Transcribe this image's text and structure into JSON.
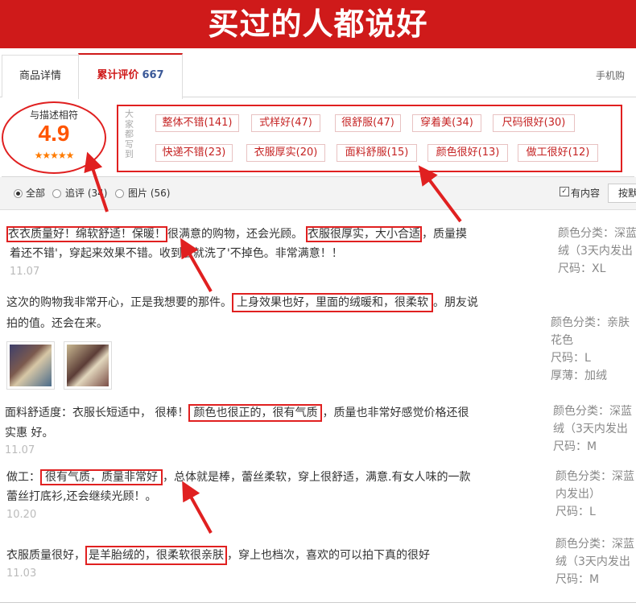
{
  "banner": {
    "title": "买过的人都说好"
  },
  "tabs": [
    {
      "label": "商品详情"
    },
    {
      "label": "累计评价",
      "count": "667"
    },
    {
      "label": "手机购"
    }
  ],
  "rating": {
    "label": "与描述相符",
    "score": "4.9",
    "stars": "★★★★★"
  },
  "tags": {
    "side_label": "大家都写到",
    "items": [
      "整体不错(141)",
      "式样好(47)",
      "很舒服(47)",
      "穿着美(34)",
      "尺码很好(30)",
      "快递不错(23)",
      "衣服厚实(20)",
      "面料舒服(15)",
      "颜色很好(13)",
      "做工很好(12)"
    ]
  },
  "filter": {
    "all": "全部",
    "followup": "追评 (34)",
    "images": "图片 (56)",
    "has_content": "有内容",
    "sort": "按默"
  },
  "reviews": [
    {
      "line1_hl1": "衣衣质量好！绵软舒适！保暖！",
      "line1_mid": "很满意的购物，还会光顾。",
      "line1_hl2": "衣服很厚实，大小合适",
      "line1_end": "，质量摸",
      "line2": "着还不错'，穿起来效果不错。收到后就洗了'不掉色。非常满意！！",
      "date": "11.07",
      "meta": [
        "颜色分类：深蓝",
        "绒（3天内发出",
        "尺码：XL"
      ]
    },
    {
      "line1_start": "这次的购物我非常开心，正是我想要的那件。",
      "line1_hl": "上身效果也好，里面的绒暖和，很柔软",
      "line1_end": "。朋友说",
      "line2": "拍的值。还会在来。",
      "meta": [
        "颜色分类：亲肤",
        "花色",
        "尺码：L",
        "厚薄：加绒"
      ]
    },
    {
      "line1_start": "面料舒适度：衣服长短适中， 很棒！",
      "line1_hl": "颜色也很正的，很有气质",
      "line1_end": "，质量也非常好感觉价格还很",
      "line2": "实惠 好。",
      "date": "11.07",
      "meta": [
        "颜色分类：深蓝",
        "绒（3天内发出",
        "尺码：M"
      ]
    },
    {
      "line1_start": "做工：",
      "line1_hl": "很有气质，质量非常好",
      "line1_end": "，总体就是棒，蕾丝柔软，穿上很舒适，满意.有女人味的一款",
      "line2": "蕾丝打底衫,还会继续光顾！。",
      "date": "10.20",
      "meta": [
        "颜色分类：深蓝",
        "内发出）",
        "尺码：L"
      ]
    },
    {
      "line1_start": "衣服质量很好，",
      "line1_hl": "是羊胎绒的，很柔软很亲肤",
      "line1_end": "，穿上也档次，喜欢的可以拍下真的很好",
      "date": "11.03",
      "meta": [
        "颜色分类：深蓝",
        "绒（3天内发出",
        "尺码：M"
      ]
    }
  ],
  "colors": {
    "accent": "#cf1a1a",
    "highlight": "#e02020",
    "score": "#ff5500"
  }
}
